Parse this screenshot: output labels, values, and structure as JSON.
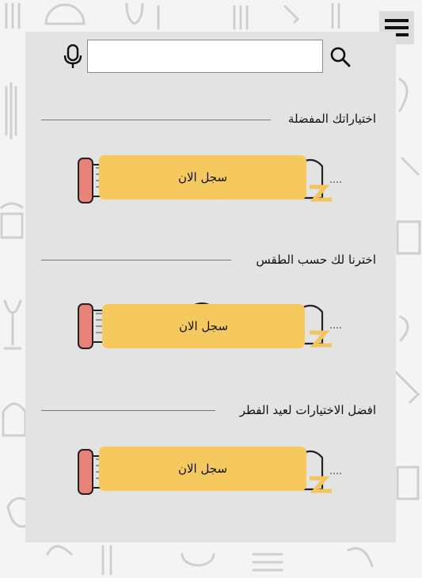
{
  "search": {
    "value": "",
    "placeholder": ""
  },
  "sections": [
    {
      "title": "اختياراتك المفضلة",
      "cta_label": "سجل الان"
    },
    {
      "title": "اخترنا لك حسب الطقس",
      "cta_label": "سجل الان"
    },
    {
      "title": "افضل الاختيارات لعيد الفطر",
      "cta_label": "سجل الان"
    }
  ],
  "colors": {
    "button": "#f5c95e",
    "panel": "#e3e3e3",
    "doodle": "#cfcfcf",
    "deco_red": "#e8837a",
    "deco_yellow": "#f2c45a"
  },
  "icons": {
    "menu": "hamburger-icon",
    "mic": "microphone-icon",
    "search": "search-icon"
  }
}
